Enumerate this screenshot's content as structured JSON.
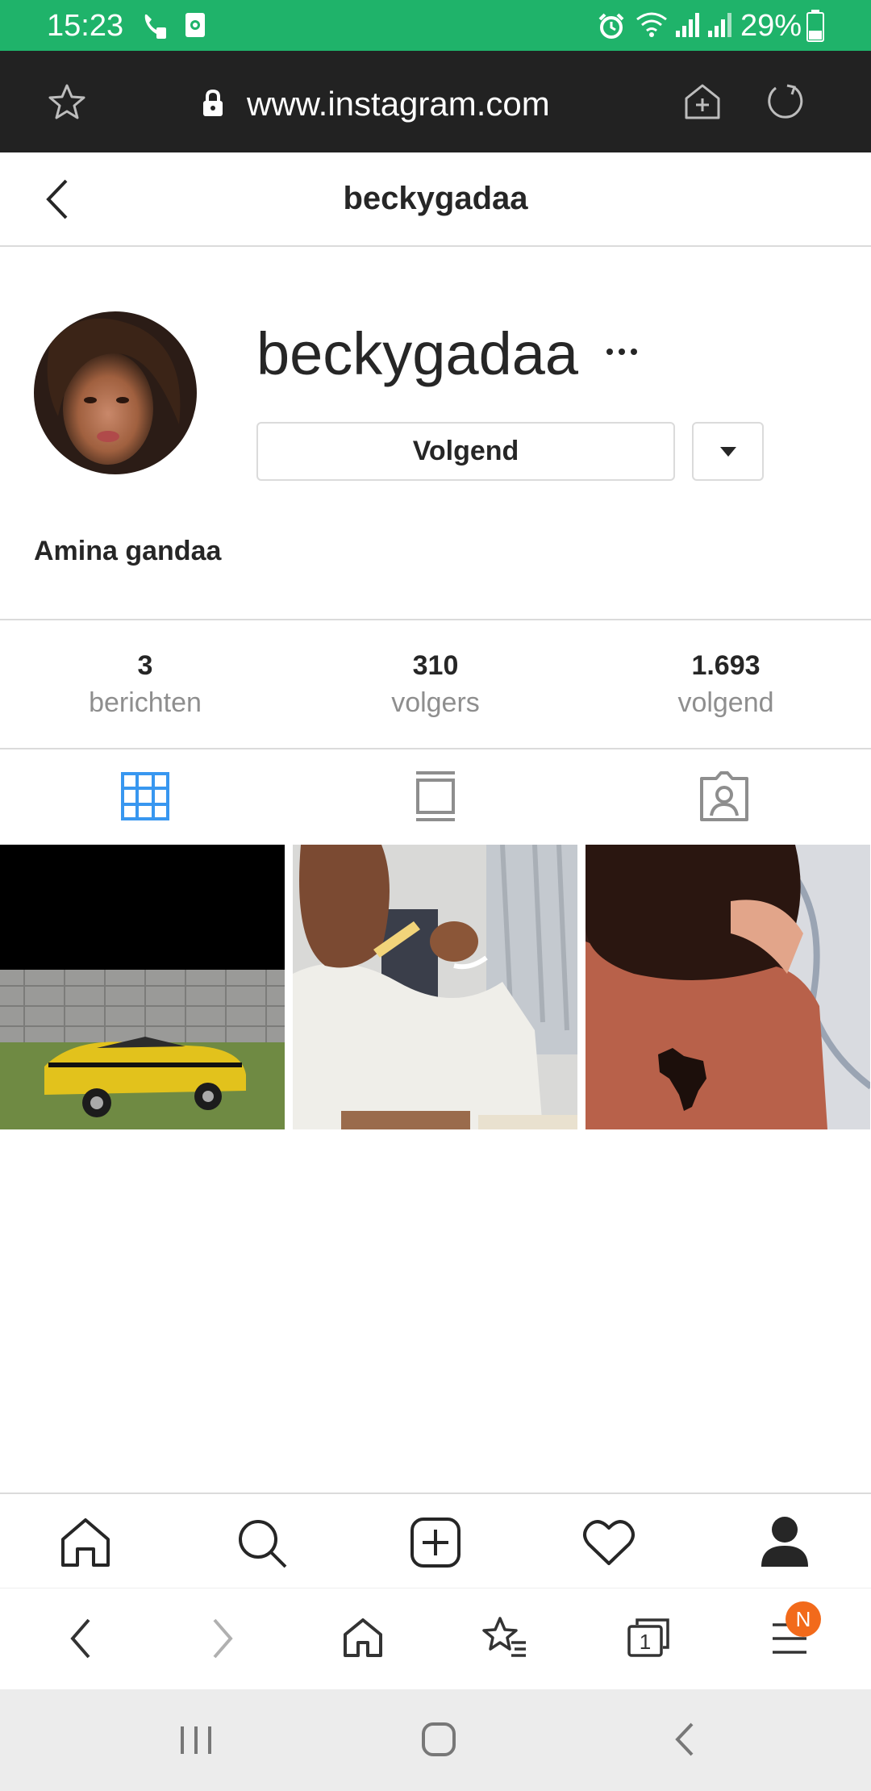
{
  "status_bar": {
    "time": "15:23",
    "battery": "29%"
  },
  "browser": {
    "url": "www.instagram.com",
    "tab_count": "1",
    "menu_badge": "N"
  },
  "header": {
    "title": "beckygadaa"
  },
  "profile": {
    "username": "beckygadaa",
    "follow_button": "Volgend",
    "full_name": "Amina gandaa"
  },
  "stats": [
    {
      "value": "3",
      "label": "berichten"
    },
    {
      "value": "310",
      "label": "volgers"
    },
    {
      "value": "1.693",
      "label": "volgend"
    }
  ],
  "colors": {
    "status_green": "#1fb36a",
    "accent_blue": "#3897f0",
    "badge_orange": "#f26a1b"
  },
  "icons": {
    "tabs": [
      "grid-icon",
      "feed-icon",
      "tagged-icon"
    ],
    "nav": [
      "home-icon",
      "search-icon",
      "add-post-icon",
      "heart-icon",
      "profile-icon"
    ]
  }
}
